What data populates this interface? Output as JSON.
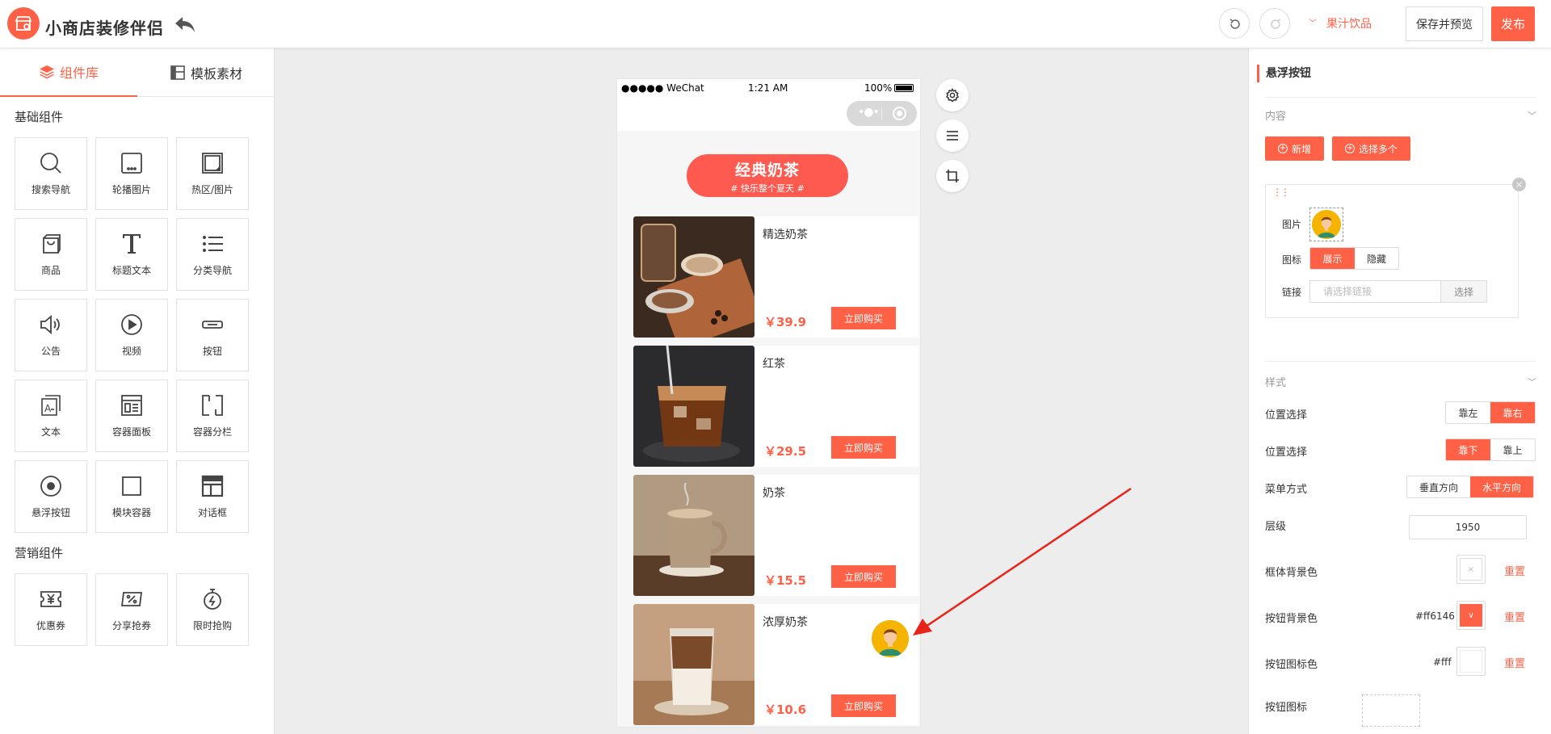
{
  "header": {
    "app_title": "小商店装修伴侣",
    "store_name": "果汁饮品",
    "save_preview_label": "保存并预览",
    "publish_label": "发布",
    "accent_color": "#ff6146"
  },
  "left_panel": {
    "tabs": [
      {
        "label": "组件库",
        "active": true
      },
      {
        "label": "模板素材",
        "active": false
      }
    ],
    "basic_section_title": "基础组件",
    "basic_components": [
      {
        "label": "搜索导航",
        "icon": "search-icon"
      },
      {
        "label": "轮播图片",
        "icon": "carousel-icon"
      },
      {
        "label": "热区/图片",
        "icon": "hotspot-image-icon"
      },
      {
        "label": "商品",
        "icon": "product-bag-icon"
      },
      {
        "label": "标题文本",
        "icon": "title-text-icon"
      },
      {
        "label": "分类导航",
        "icon": "category-list-icon"
      },
      {
        "label": "公告",
        "icon": "speaker-icon"
      },
      {
        "label": "视频",
        "icon": "video-play-icon"
      },
      {
        "label": "按钮",
        "icon": "button-icon"
      },
      {
        "label": "文本",
        "icon": "text-icon"
      },
      {
        "label": "容器面板",
        "icon": "container-panel-icon"
      },
      {
        "label": "容器分栏",
        "icon": "container-columns-icon"
      },
      {
        "label": "悬浮按钮",
        "icon": "floating-button-icon"
      },
      {
        "label": "模块容器",
        "icon": "module-container-icon"
      },
      {
        "label": "对话框",
        "icon": "dialog-icon"
      }
    ],
    "marketing_section_title": "营销组件",
    "marketing_components": [
      {
        "label": "优惠券",
        "icon": "coupon-icon"
      },
      {
        "label": "分享抢券",
        "icon": "share-coupon-icon"
      },
      {
        "label": "限时抢购",
        "icon": "flash-sale-timer-icon"
      }
    ]
  },
  "phone": {
    "status_left": "●●●●● WeChat",
    "status_time": "1:21 AM",
    "status_battery": "100%",
    "banner_title": "经典奶茶",
    "banner_subtitle": "# 快乐整个夏天 #",
    "products": [
      {
        "name": "精选奶茶",
        "price": "￥39.9",
        "buy_label": "立即购买"
      },
      {
        "name": "红茶",
        "price": "￥29.5",
        "buy_label": "立即购买"
      },
      {
        "name": "奶茶",
        "price": "￥15.5",
        "buy_label": "立即购买"
      },
      {
        "name": "浓厚奶茶",
        "price": "￥10.6",
        "buy_label": "立即购买"
      }
    ]
  },
  "right_panel": {
    "title": "悬浮按钮",
    "content_section": "内容",
    "add_label": "新增",
    "select_multi_label": "选择多个",
    "item": {
      "image_label": "图片",
      "icon_label": "图标",
      "show_label": "展示",
      "hide_label": "隐藏",
      "link_label": "链接",
      "link_placeholder": "请选择链接",
      "choose_label": "选择"
    },
    "style_section": "样式",
    "position_h": {
      "label": "位置选择",
      "left": "靠左",
      "right": "靠右",
      "selected": "right"
    },
    "position_v": {
      "label": "位置选择",
      "bottom": "靠下",
      "top": "靠上",
      "selected": "bottom"
    },
    "menu_mode": {
      "label": "菜单方式",
      "vertical": "垂直方向",
      "horizontal": "水平方向",
      "selected": "horizontal"
    },
    "z_index": {
      "label": "层级",
      "value": "1950"
    },
    "frame_bg": {
      "label": "框体背景色",
      "reset": "重置"
    },
    "button_bg": {
      "label": "按钮背景色",
      "hex": "#ff6146",
      "color": "#ff6146",
      "reset": "重置"
    },
    "button_icon_color": {
      "label": "按钮图标色",
      "hex": "#fff",
      "color": "#ffffff",
      "reset": "重置"
    },
    "button_icon": {
      "label": "按钮图标"
    }
  }
}
